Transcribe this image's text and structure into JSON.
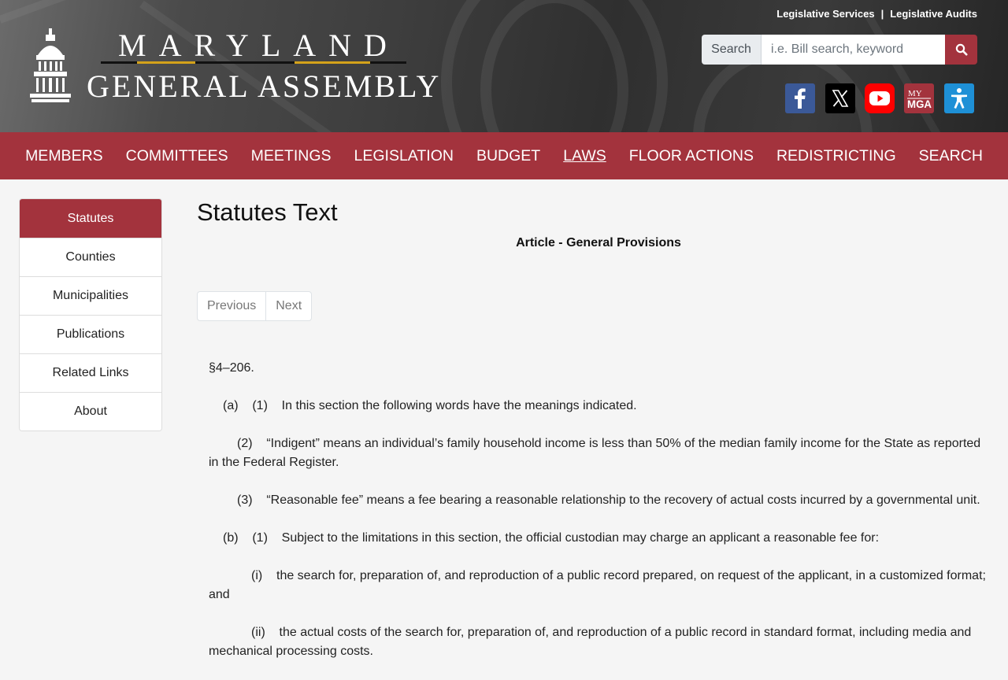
{
  "header": {
    "logo_line1": "MARYLAND",
    "logo_line2": "GENERAL ASSEMBLY",
    "top_links": [
      "Legislative Services",
      "Legislative Audits"
    ],
    "search_label": "Search",
    "search_placeholder": "i.e. Bill search, keyword",
    "social": [
      {
        "name": "facebook-icon",
        "color": "#3b5998"
      },
      {
        "name": "x-twitter-icon",
        "color": "#000000"
      },
      {
        "name": "youtube-icon",
        "color": "#ff0000"
      },
      {
        "name": "mymga-icon",
        "color": "#a3333d",
        "text": "MY MGA"
      },
      {
        "name": "accessibility-icon",
        "color": "#1e90d6"
      }
    ]
  },
  "nav": {
    "items": [
      "MEMBERS",
      "COMMITTEES",
      "MEETINGS",
      "LEGISLATION",
      "BUDGET",
      "LAWS",
      "FLOOR ACTIONS",
      "REDISTRICTING",
      "SEARCH"
    ],
    "active": "LAWS"
  },
  "sidebar": {
    "items": [
      "Statutes",
      "Counties",
      "Municipalities",
      "Publications",
      "Related Links",
      "About"
    ],
    "active": "Statutes"
  },
  "main": {
    "page_title": "Statutes Text",
    "article_title": "Article - General Provisions",
    "pager": {
      "previous": "Previous",
      "next": "Next"
    },
    "section": "§4–206.",
    "paragraphs": [
      "(a)    (1)    In this section the following words have the meanings indicated.",
      "(2)    “Indigent” means an individual’s family household income is less than 50% of the median family income for the State as reported in the Federal Register.",
      "(3)    “Reasonable fee” means a fee bearing a reasonable relationship to the recovery of actual costs incurred by a governmental unit.",
      "(b)    (1)    Subject to the limitations in this section, the official custodian may charge an applicant a reasonable fee for:",
      "(i)    the search for, preparation of, and reproduction of a public record prepared, on request of the applicant, in a customized format; and",
      "(ii)    the actual costs of the search for, preparation of, and reproduction of a public record in standard format, including media and mechanical processing costs."
    ]
  }
}
